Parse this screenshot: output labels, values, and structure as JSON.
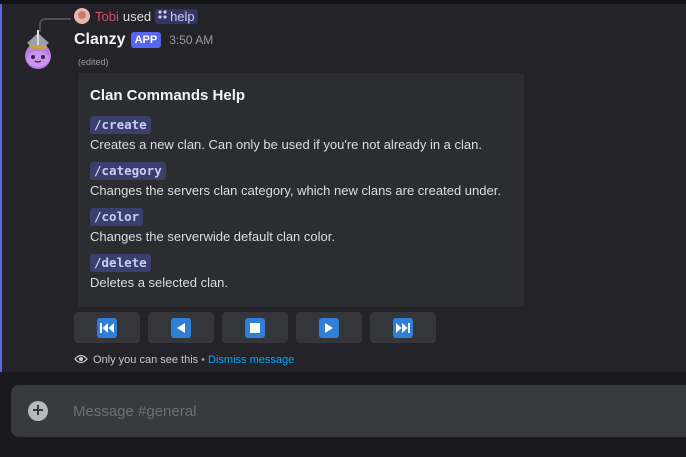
{
  "reply": {
    "user": "Tobi",
    "used_text": "used",
    "command": "help"
  },
  "message": {
    "author": "Clanzy",
    "badge": "APP",
    "timestamp": "3:50 AM",
    "edited": "(edited)"
  },
  "embed": {
    "title": "Clan Commands Help",
    "commands": [
      {
        "name": "/create",
        "description": "Creates a new clan. Can only be used if you're not already in a clan."
      },
      {
        "name": "/category",
        "description": "Changes the servers clan category, which new clans are created under."
      },
      {
        "name": "/color",
        "description": "Changes the serverwide default clan color."
      },
      {
        "name": "/delete",
        "description": "Deletes a selected clan."
      }
    ]
  },
  "buttons": [
    {
      "icon": "first-page-icon"
    },
    {
      "icon": "previous-page-icon"
    },
    {
      "icon": "stop-icon"
    },
    {
      "icon": "next-page-icon"
    },
    {
      "icon": "last-page-icon"
    }
  ],
  "ephemeral": {
    "notice": "Only you can see this",
    "separator": "•",
    "dismiss": "Dismiss message"
  },
  "composer": {
    "placeholder": "Message #general"
  },
  "colors": {
    "accent": "#5865f2",
    "button_icon": "#2f7fd6",
    "link": "#00a8fc",
    "reply_user": "#d94f6e"
  }
}
